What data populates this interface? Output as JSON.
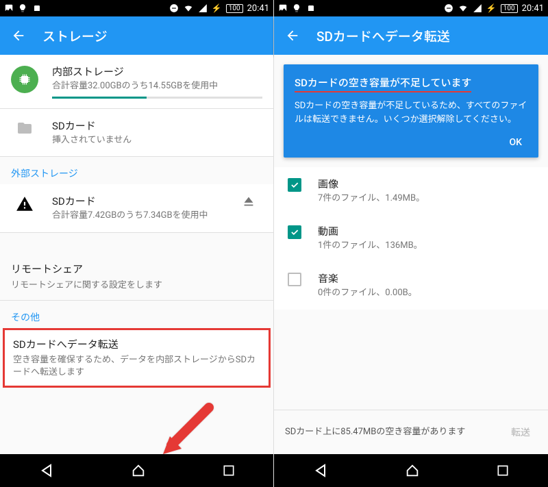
{
  "status": {
    "time": "20:41",
    "battery": "100"
  },
  "left": {
    "title": "ストレージ",
    "internal": {
      "title": "内部ストレージ",
      "sub": "合計容量32.00GBのうち14.55GBを使用中",
      "progress_pct": 45
    },
    "sd_missing": {
      "title": "SDカード",
      "sub": "挿入されていません"
    },
    "external_label": "外部ストレージ",
    "sd_external": {
      "title": "SDカード",
      "sub": "合計容量7.42GBのうち7.34GBを使用中"
    },
    "remote": {
      "title": "リモートシェア",
      "sub": "リモートシェアに関する設定をします"
    },
    "other_label": "その他",
    "transfer": {
      "title": "SDカードへデータ転送",
      "sub": "空き容量を確保するため、データを内部ストレージからSDカードへ転送します"
    }
  },
  "right": {
    "title": "SDカードへデータ転送",
    "alert": {
      "title": "SDカードの空き容量が不足しています",
      "body": "SDカードの空き容量が不足しているため、すべてのファイルは転送できません。いくつか選択解除してください。",
      "ok": "OK"
    },
    "items": [
      {
        "checked": true,
        "title": "画像",
        "sub": "7件のファイル、1.49MB。"
      },
      {
        "checked": true,
        "title": "動画",
        "sub": "1件のファイル、136MB。"
      },
      {
        "checked": false,
        "title": "音楽",
        "sub": "0件のファイル、0.00B。"
      }
    ],
    "footer": "SDカード上に85.47MBの空き容量があります",
    "transfer_btn": "転送"
  }
}
